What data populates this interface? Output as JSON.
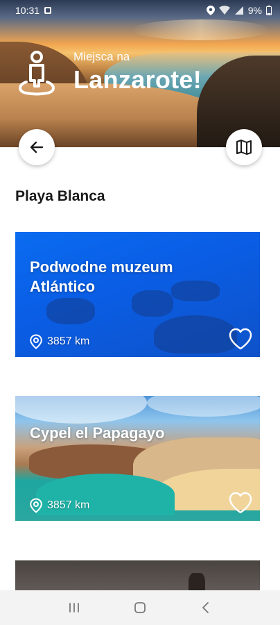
{
  "status_bar": {
    "time": "10:31",
    "battery": "9%"
  },
  "header": {
    "subtitle": "Miejsca na",
    "title": "Lanzarote!"
  },
  "section": {
    "title": "Playa Blanca"
  },
  "places": [
    {
      "name": "Podwodne muzeum Atlántico",
      "distance": "3857 km",
      "favorite": false
    },
    {
      "name": "Cypel el Papagayo",
      "distance": "3857 km",
      "favorite": false
    },
    {
      "name": "",
      "distance": "",
      "favorite": false
    }
  ],
  "icons": {
    "back": "arrow-left-icon",
    "map": "map-icon",
    "location": "location-pin-icon",
    "favorite": "heart-outline-icon",
    "logo": "person-pin-icon"
  },
  "colors": {
    "card_blue": "#0a5ee6",
    "text_dark": "#1a1a1a",
    "white": "#ffffff"
  }
}
